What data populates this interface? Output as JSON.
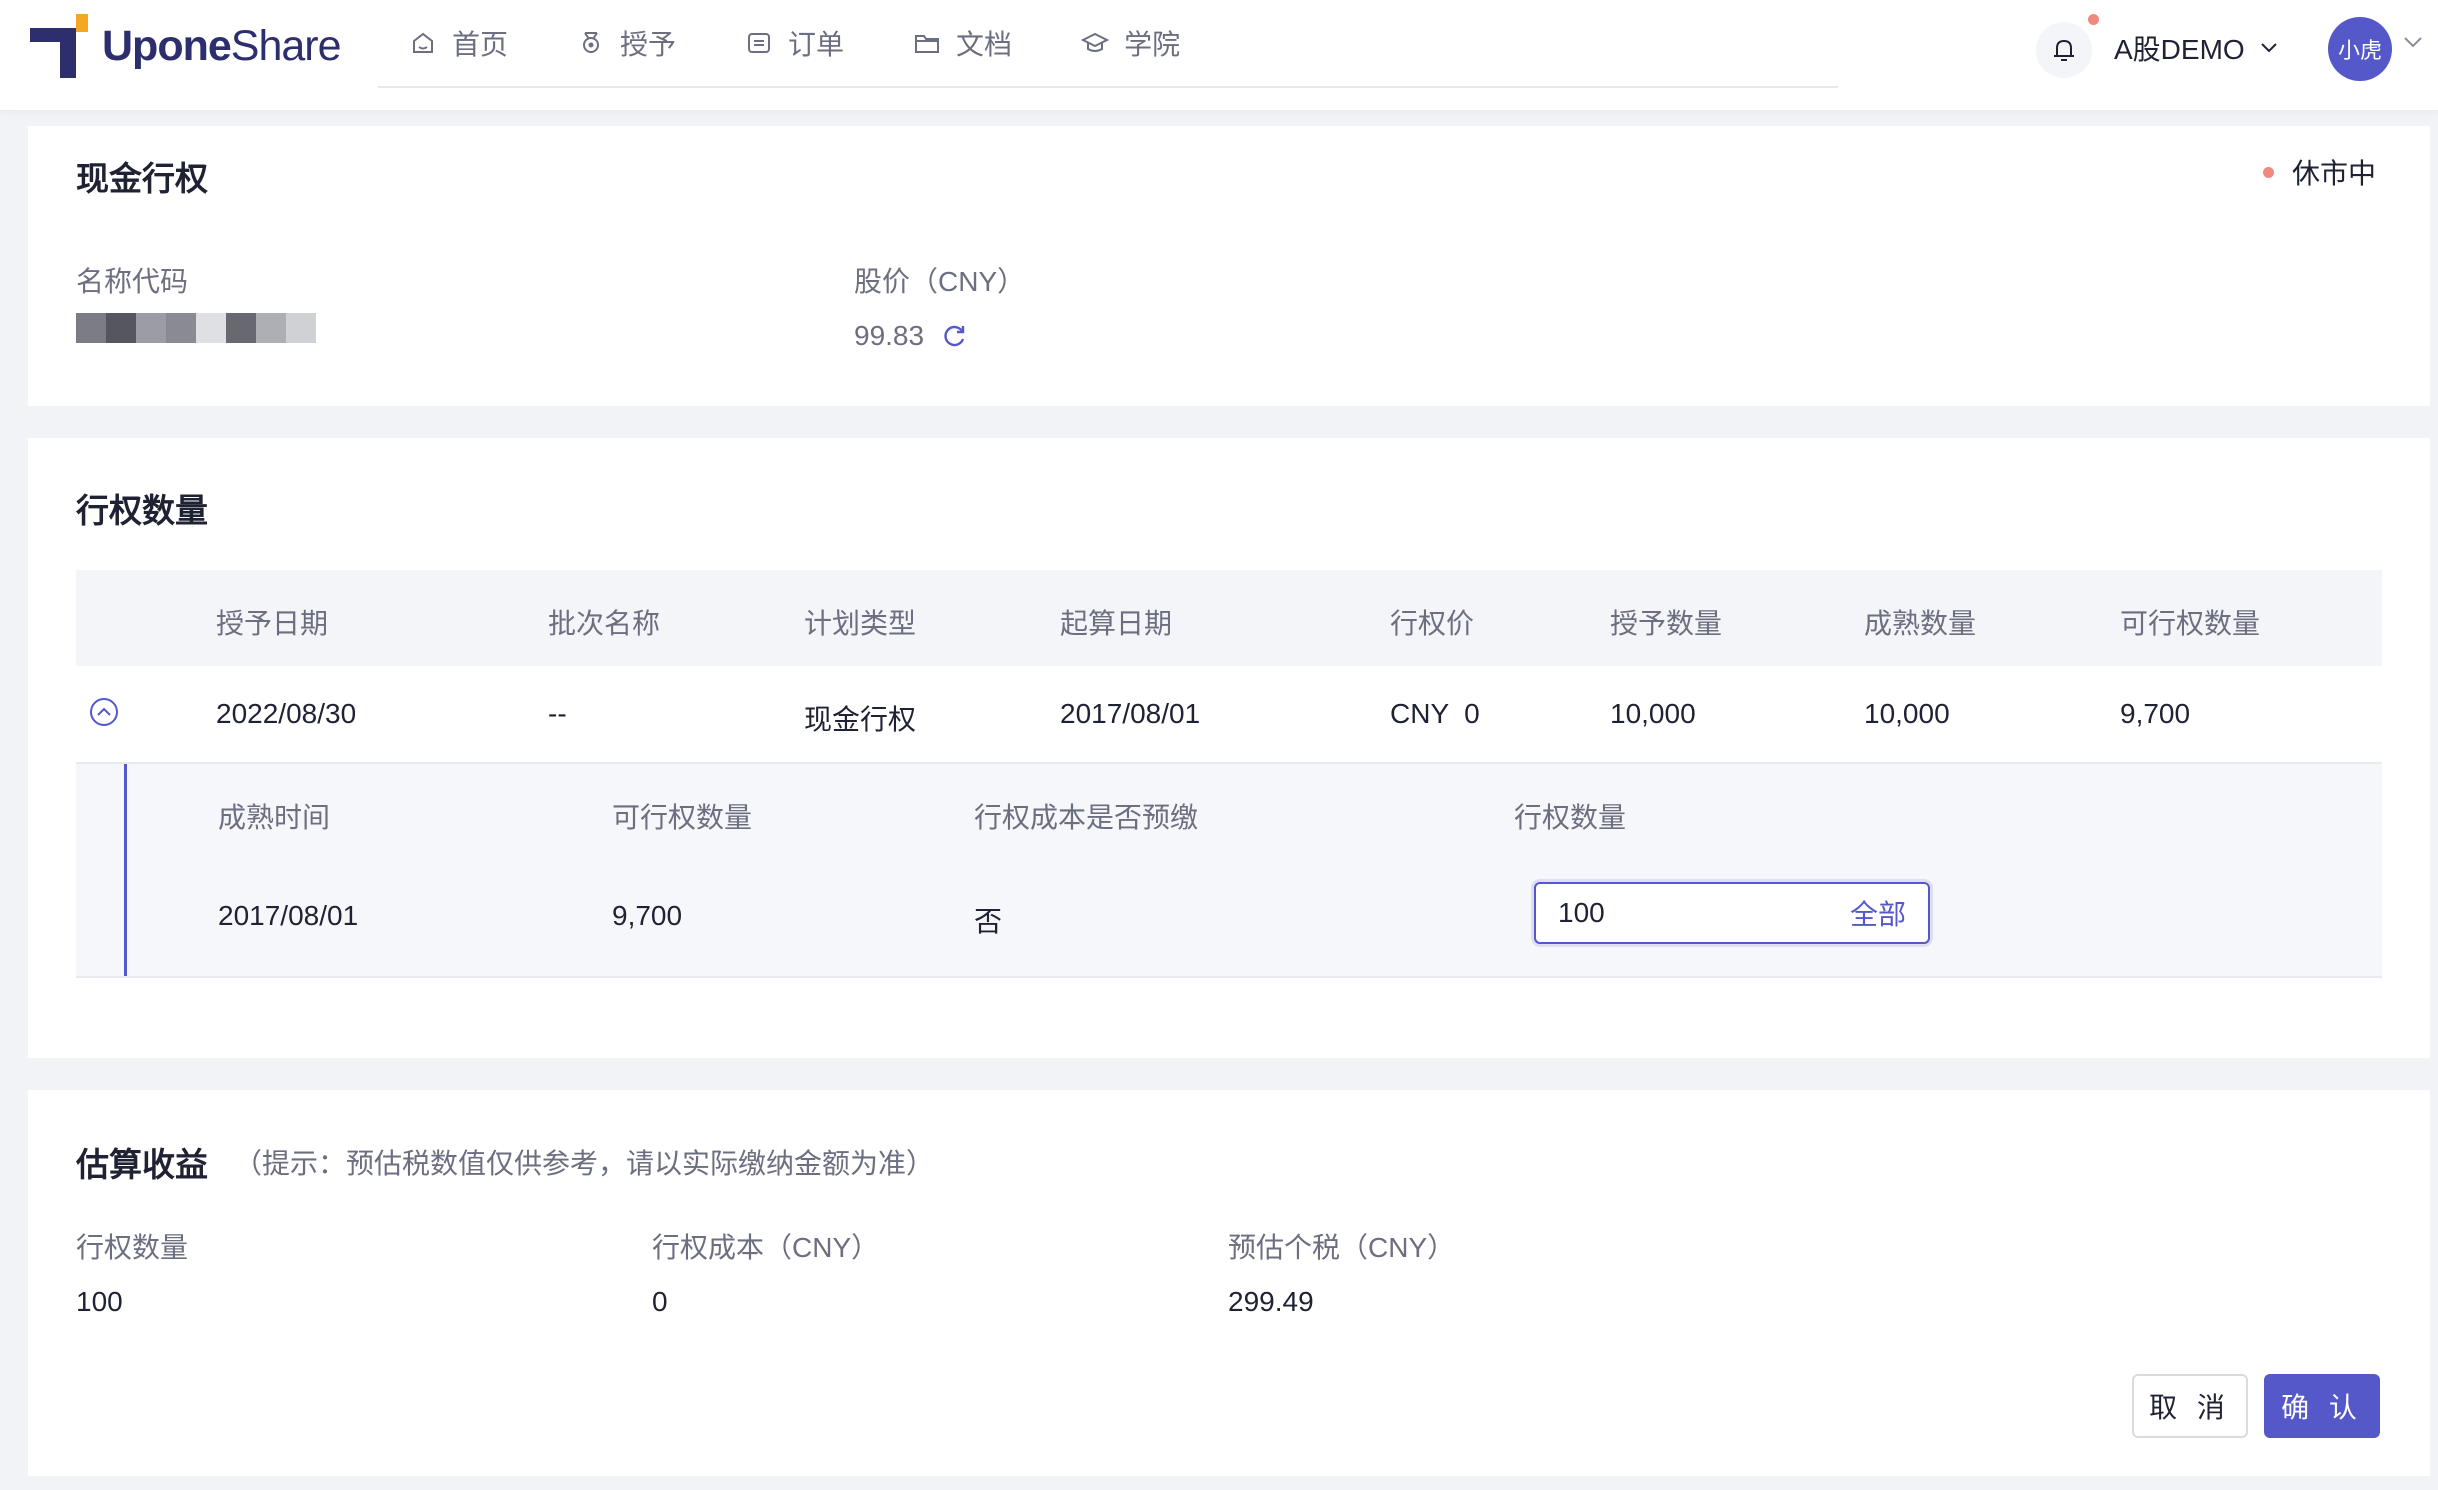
{
  "brand": {
    "name_bold": "Upone",
    "name_light": "Share"
  },
  "nav": [
    {
      "label": "首页",
      "icon": "home-icon"
    },
    {
      "label": "授予",
      "icon": "medal-icon"
    },
    {
      "label": "订单",
      "icon": "order-icon"
    },
    {
      "label": "文档",
      "icon": "folder-icon"
    },
    {
      "label": "学院",
      "icon": "graduation-cap-icon"
    }
  ],
  "header": {
    "account": "A股DEMO",
    "avatar": "小虎"
  },
  "cash_exercise": {
    "title": "现金行权",
    "market_status": "休市中",
    "name_code_label": "名称代码",
    "price_label": "股价（CNY）",
    "price_value": "99.83"
  },
  "exercise_qty": {
    "title": "行权数量",
    "columns": [
      "授予日期",
      "批次名称",
      "计划类型",
      "起算日期",
      "行权价",
      "授予数量",
      "成熟数量",
      "可行权数量"
    ],
    "row": {
      "grant_date": "2022/08/30",
      "batch_name": "--",
      "plan_type": "现金行权",
      "start_date": "2017/08/01",
      "exercise_price": "CNY  0",
      "granted": "10,000",
      "vested": "10,000",
      "exercisable": "9,700"
    },
    "sub_columns": [
      "成熟时间",
      "可行权数量",
      "行权成本是否预缴",
      "行权数量"
    ],
    "sub_row": {
      "vest_time": "2017/08/01",
      "exercisable": "9,700",
      "prepaid": "否",
      "qty_value": "100",
      "all_label": "全部"
    }
  },
  "estimate": {
    "title": "估算收益",
    "hint": "（提示：预估税数值仅供参考，请以实际缴纳金额为准）",
    "qty_label": "行权数量",
    "qty_value": "100",
    "cost_label": "行权成本（CNY）",
    "cost_value": "0",
    "tax_label": "预估个税（CNY）",
    "tax_value": "299.49"
  },
  "actions": {
    "cancel": "取 消",
    "confirm": "确 认"
  },
  "colors": {
    "accent": "#5558c8",
    "status_dot": "#f08a7d",
    "brand": "#2c2e6e"
  }
}
